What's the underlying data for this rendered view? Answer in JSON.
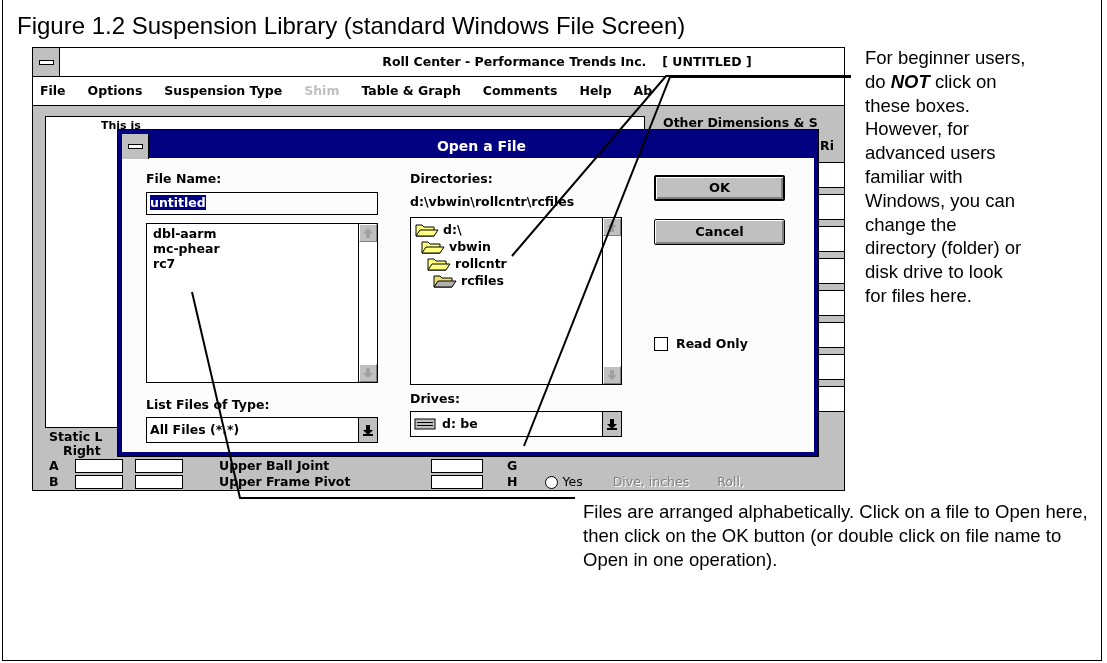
{
  "figure_title": "Figure 1.2  Suspension Library (standard Windows File Screen)",
  "window": {
    "title": "Roll Center - Performance Trends Inc.",
    "document": "[ UNTITLED ]",
    "menu": [
      {
        "label": "File",
        "disabled": false
      },
      {
        "label": "Options",
        "disabled": false
      },
      {
        "label": "Suspension Type",
        "disabled": false
      },
      {
        "label": "Shim",
        "disabled": true
      },
      {
        "label": "Table & Graph",
        "disabled": false
      },
      {
        "label": "Comments",
        "disabled": false
      },
      {
        "label": "Help",
        "disabled": false
      },
      {
        "label": "Ab",
        "disabled": false
      }
    ],
    "description_text": "This is",
    "group_label": "Other Dimensions & S",
    "column_label": "Ri",
    "static_group_label": "Static L",
    "side_label": "Right",
    "rows": [
      {
        "label": "A",
        "name": "Upper Ball Joint",
        "code": "G"
      },
      {
        "label": "B",
        "name": "Upper Frame Pivot",
        "code": "H"
      }
    ],
    "radio": {
      "label": "Yes",
      "selected": false
    },
    "dive_field": {
      "label": "Dive, inches",
      "disabled": true
    },
    "cut_label": "Roll,"
  },
  "dialog": {
    "title": "Open a File",
    "file_name": {
      "label": "File Name:",
      "value": "untitled",
      "text_selected": true
    },
    "files": [
      "dbl-aarm",
      "mc-phear",
      "rc7"
    ],
    "file_type": {
      "label": "List Files of Type:",
      "value": "All Files (*.*)"
    },
    "directories": {
      "label": "Directories:",
      "path": "d:\\vbwin\\rollcntr\\rcfiles",
      "tree": [
        {
          "name": "d:\\",
          "selected": false,
          "children": [
            {
              "name": "vbwin",
              "selected": false,
              "children": [
                {
                  "name": "rollcntr",
                  "selected": false,
                  "children": [
                    {
                      "name": "rcfiles",
                      "selected": true
                    }
                  ]
                }
              ]
            }
          ]
        }
      ]
    },
    "drives": {
      "label": "Drives:",
      "value": "d: be"
    },
    "buttons": [
      {
        "label": "OK",
        "default": true
      },
      {
        "label": "Cancel",
        "default": false
      }
    ],
    "read_only": {
      "label": "Read Only",
      "checked": false
    }
  },
  "notes": [
    {
      "text": "For beginner users,\ndo **NOT** click on\nthese boxes.\nHowever, for\nadvanced users\nfamiliar with\nWindows, you can\nchange the\ndirectory (folder) or\ndisk drive to look\nfor files here."
    },
    {
      "text": "Files are arranged alphabetically.  Click on a file to Open here,\nthen click on the OK button (or double click on file name to\nOpen in one operation)."
    }
  ]
}
